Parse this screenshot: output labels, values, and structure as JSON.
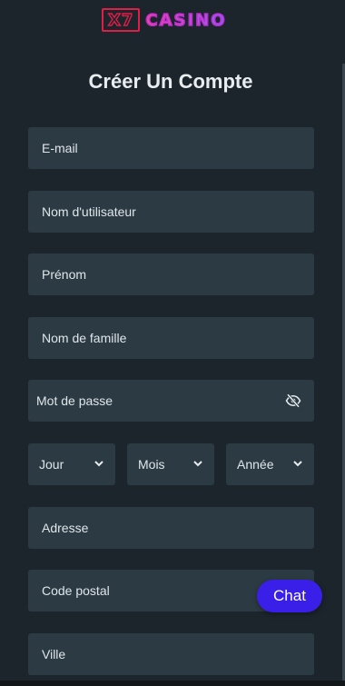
{
  "brand": {
    "logo_mark": "X7",
    "logo_word": "CASINO"
  },
  "form": {
    "title": "Créer Un Compte",
    "email_placeholder": "E-mail",
    "username_placeholder": "Nom d'utilisateur",
    "firstname_placeholder": "Prénom",
    "lastname_placeholder": "Nom de famille",
    "password_placeholder": "Mot de passe",
    "password_toggle_icon": "eye-slash-icon",
    "birthdate": {
      "day_label": "Jour",
      "month_label": "Mois",
      "year_label": "Année"
    },
    "address_placeholder": "Adresse",
    "postal_code_placeholder": "Code postal",
    "city_placeholder": "Ville"
  },
  "chat": {
    "label": "Chat",
    "color": "#3a1fe8"
  },
  "colors": {
    "background": "#1b252b",
    "field": "#2c3b43",
    "logo_red": "#e11d48",
    "logo_purple": "#c026d3"
  }
}
